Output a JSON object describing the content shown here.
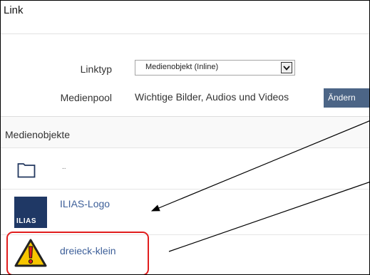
{
  "window": {
    "title": "Link"
  },
  "form": {
    "linktyp_label": "Linktyp",
    "linktyp_value": "Medienobjekt (Inline)",
    "medienpool_label": "Medienpool",
    "medienpool_value": "Wichtige Bilder, Audios und Videos",
    "aendern_label": "Ändern"
  },
  "section": {
    "title": "Medienobjekte"
  },
  "items": [
    {
      "label": "..",
      "icon": "folder-icon"
    },
    {
      "label": "ILIAS-Logo",
      "icon": "ilias-logo-icon",
      "icon_text": "ILIAS"
    },
    {
      "label": "dreieck-klein",
      "icon": "warning-triangle-icon"
    }
  ],
  "colors": {
    "button_bg": "#4c6586",
    "link": "#3d5f99",
    "highlight": "#e11d1d",
    "ilias_icon_bg": "#1f3865",
    "warning_yellow": "#f7c600"
  }
}
